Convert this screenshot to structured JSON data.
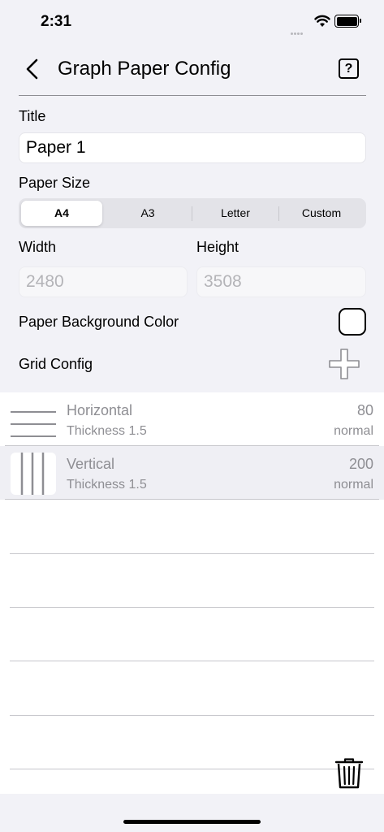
{
  "status": {
    "time": "2:31"
  },
  "header": {
    "title": "Graph Paper Config",
    "help_label": "?"
  },
  "form": {
    "title_label": "Title",
    "title_value": "Paper 1",
    "paper_size_label": "Paper Size",
    "paper_sizes": [
      "A4",
      "A3",
      "Letter",
      "Custom"
    ],
    "selected_paper_size": "A4",
    "width_label": "Width",
    "width_value": "2480",
    "height_label": "Height",
    "height_value": "3508",
    "background_color_label": "Paper Background Color",
    "background_color": "#ffffff",
    "grid_config_label": "Grid Config"
  },
  "grid_items": [
    {
      "name": "Horizontal",
      "thickness": "Thickness 1.5",
      "value": "80",
      "style": "normal",
      "icon": "horizontal-lines-icon"
    },
    {
      "name": "Vertical",
      "thickness": "Thickness 1.5",
      "value": "200",
      "style": "normal",
      "icon": "vertical-lines-icon"
    }
  ],
  "colors": {
    "background": "#f2f2f7",
    "selected_row": "#efeff4",
    "secondary_text": "#8e8e93"
  }
}
